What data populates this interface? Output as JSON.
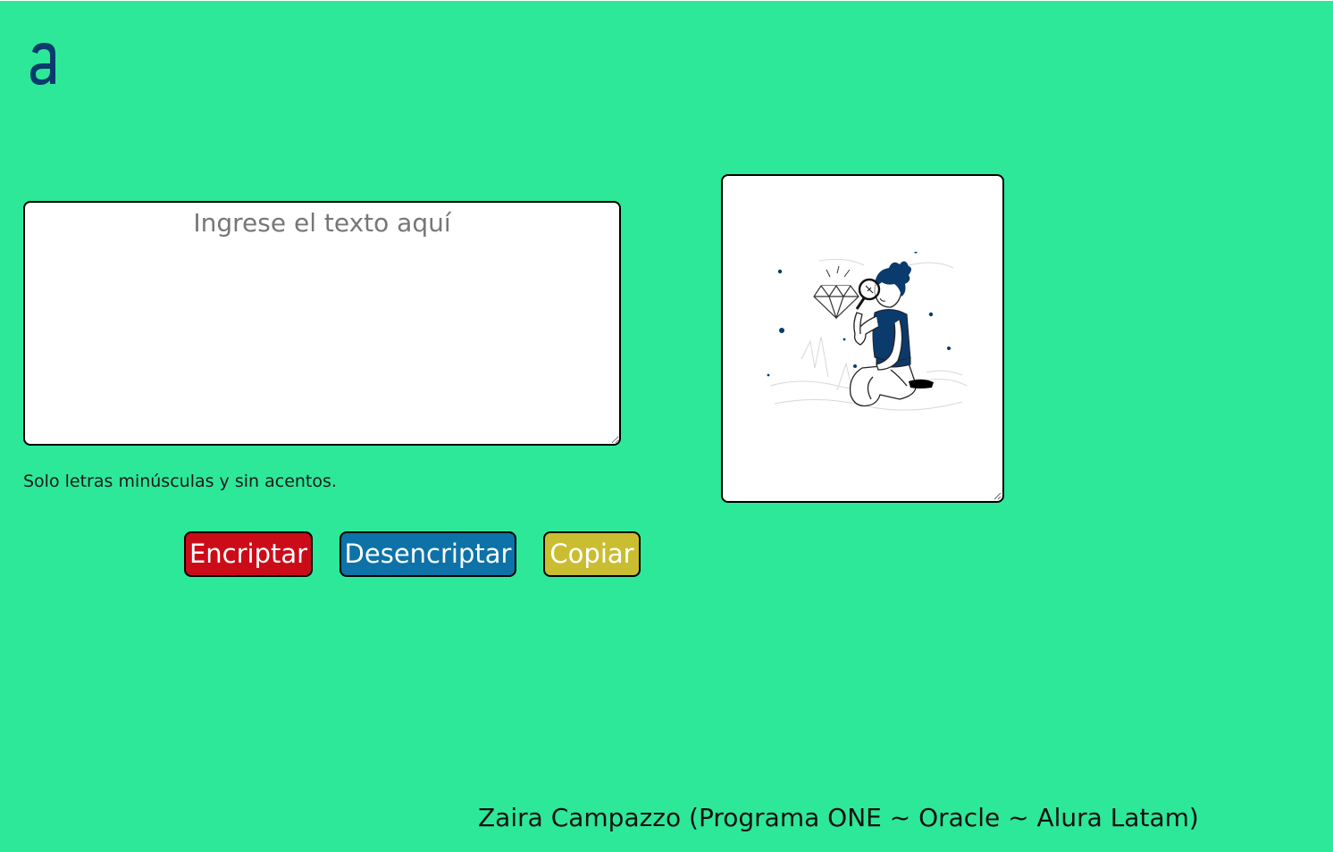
{
  "app": {
    "logo_icon": "alura-logo-icon",
    "background_color": "#2de899"
  },
  "input": {
    "placeholder": "Ingrese el texto aquí",
    "value": ""
  },
  "hint": "Solo letras minúsculas y sin acentos.",
  "buttons": {
    "encrypt_label": "Encriptar",
    "decrypt_label": "Desencriptar",
    "copy_label": "Copiar",
    "encrypt_color": "#cc0b19",
    "decrypt_color": "#0d72a8",
    "copy_color": "#cabd32"
  },
  "output": {
    "illustration_icon": "person-with-magnifier-illustration"
  },
  "footer": "Zaira Campazzo (Programa ONE ~ Oracle ~ Alura Latam)"
}
